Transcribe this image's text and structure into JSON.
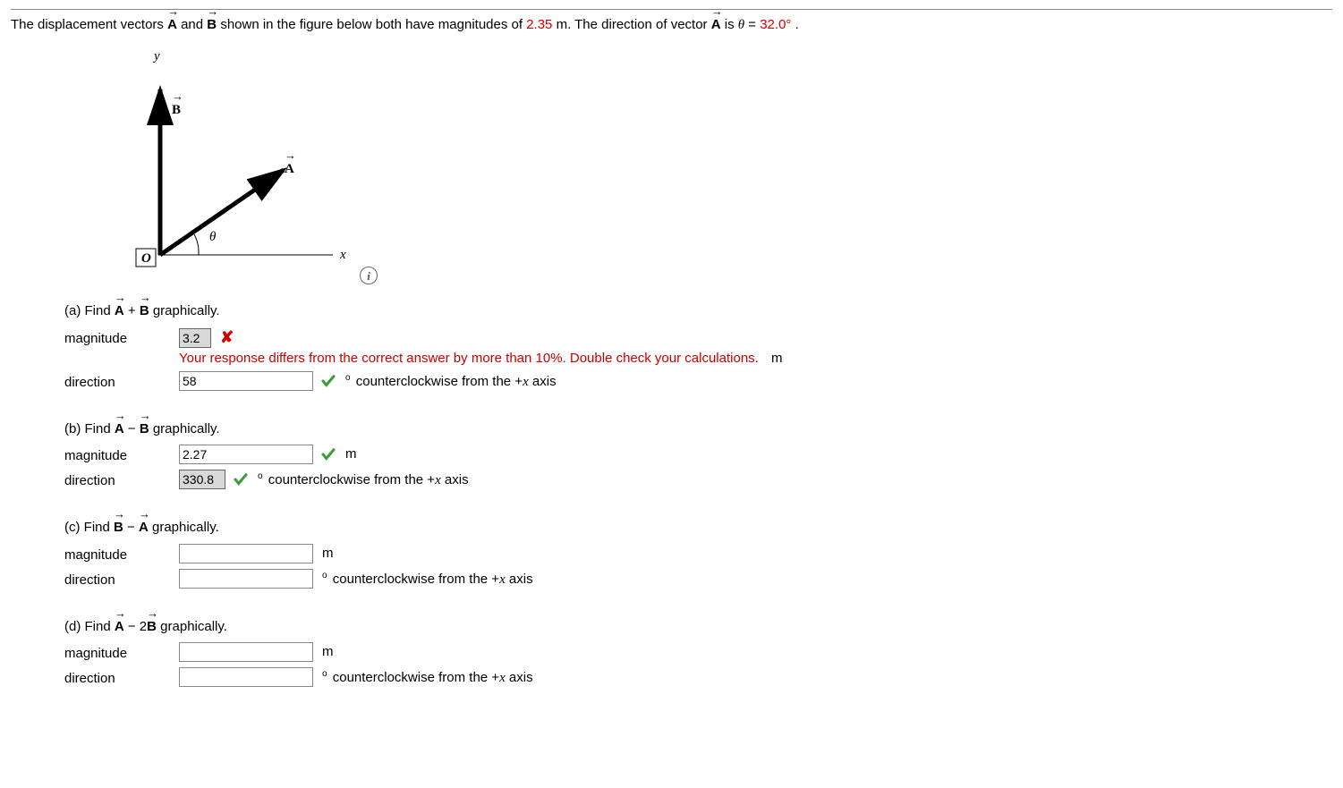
{
  "problem": {
    "text_p1": "The displacement vectors ",
    "vecA": "A",
    "text_p2": " and ",
    "vecB": "B",
    "text_p3": " shown in the figure below both have magnitudes of ",
    "magnitude_val": "2.35",
    "text_p4": " m. The direction of vector ",
    "vecA2": "A",
    "text_p5": " is ",
    "theta_sym": "θ",
    "text_p6": " = ",
    "theta_val": "32.0°",
    "text_p7": "."
  },
  "figure": {
    "y_label": "y",
    "x_label": "x",
    "o_label": "O",
    "theta_label": "θ",
    "a_label": "A",
    "b_label": "B"
  },
  "labels": {
    "magnitude": "magnitude",
    "direction": "direction",
    "m_unit": "m",
    "ccw_text": " counterclockwise from the +",
    "x_axis": "x",
    "axis_word": " axis",
    "graphically": " graphically."
  },
  "parts": {
    "a": {
      "prefix": "(a) Find ",
      "op": " + ",
      "mag_value": "3.2",
      "feedback": "Your response differs from the correct answer by more than 10%. Double check your calculations.",
      "dir_value": "58"
    },
    "b": {
      "prefix": "(b) Find ",
      "op": " − ",
      "mag_value": "2.27",
      "dir_value": "330.8"
    },
    "c": {
      "prefix": "(c) Find ",
      "op": " − ",
      "mag_value": "",
      "dir_value": ""
    },
    "d": {
      "prefix": "(d) Find ",
      "op": " − 2",
      "mag_value": "",
      "dir_value": ""
    }
  }
}
